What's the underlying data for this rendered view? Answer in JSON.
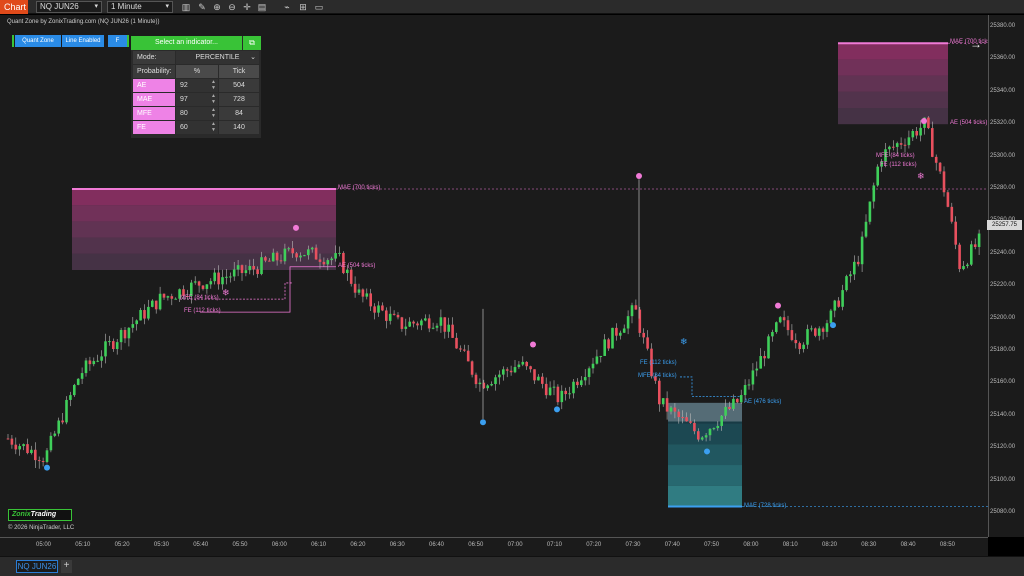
{
  "toolbar": {
    "chart_tab": "Chart",
    "instrument": "NQ JUN26",
    "interval": "1 Minute",
    "icons": [
      "bar-style-icon",
      "draw-tool-icon",
      "zoom-in-icon",
      "zoom-out-icon",
      "crosshair-icon",
      "properties-icon",
      "indicators-icon",
      "strategies-icon",
      "templates-icon"
    ]
  },
  "chart_title": "Quant Zone by ZonixTrading.com (NQ JUN26 (1 Minute))",
  "buttons": {
    "quant_zone": "Quant Zone",
    "line_enabled": "Line Enabled",
    "f": "F"
  },
  "panel": {
    "select_label": "Select an indicator...",
    "mode_label": "Mode:",
    "mode_value": "PERCENTILE",
    "probability_label": "Probability:",
    "pct_header": "%",
    "tick_header": "Tick",
    "rows": [
      {
        "name": "AE",
        "pct": "92",
        "tick": "504"
      },
      {
        "name": "MAE",
        "pct": "97",
        "tick": "728"
      },
      {
        "name": "MFE",
        "pct": "80",
        "tick": "84"
      },
      {
        "name": "FE",
        "pct": "60",
        "tick": "140"
      }
    ]
  },
  "chart_data": {
    "type": "candlestick",
    "instrument": "NQ JUN26",
    "interval": "1 Minute",
    "ylim": [
      25060,
      25390
    ],
    "price_ticks": [
      "25380.00",
      "25360.00",
      "25340.00",
      "25320.00",
      "25300.00",
      "25280.00",
      "25260.00",
      "25240.00",
      "25220.00",
      "25200.00",
      "25180.00",
      "25160.00",
      "25140.00",
      "25120.00",
      "25100.00",
      "25080.00"
    ],
    "time_ticks": [
      "05:00",
      "05:10",
      "05:20",
      "05:30",
      "05:40",
      "05:50",
      "06:00",
      "06:10",
      "06:20",
      "06:30",
      "06:40",
      "06:50",
      "07:00",
      "07:10",
      "07:20",
      "07:30",
      "07:40",
      "07:50",
      "08:00",
      "08:10",
      "08:20",
      "08:30",
      "08:40",
      "08:50"
    ],
    "current_price": "25257.75",
    "zones": [
      {
        "name": "short-zone-1",
        "color": "#f07ad6",
        "top": 25280,
        "bottom": 25230,
        "mae_label": "MAE (700 ticks)",
        "ae_label": "AE (504 ticks)",
        "mfe_label": "MFE (84 ticks)",
        "fe_label": "FE (112 ticks)"
      },
      {
        "name": "long-zone",
        "color": "#3b9ff0",
        "top": 25148,
        "bottom": 25084,
        "mae_label": "MAE (728 ticks)",
        "ae_label": "AE (476 ticks)",
        "mfe_label": "MFE (84 ticks)",
        "fe_label": "FE (112 ticks)"
      },
      {
        "name": "short-zone-2",
        "color": "#f07ad6",
        "top": 25370,
        "bottom": 25320,
        "mae_label": "MAE (700 ticks)",
        "ae_label": "AE (504 ticks)",
        "mfe_label": "MFE (84 ticks)",
        "fe_label": "FE (112 ticks)"
      }
    ],
    "colors": {
      "up": "#3fcf5a",
      "down": "#e8505e",
      "background": "#1b1b1b"
    }
  },
  "footer": {
    "logo_a": "Zonix",
    "logo_b": "Trading",
    "copyright": "© 2026 NinjaTrader, LLC",
    "instrument_tab": "NQ JUN26",
    "add_tab": "+"
  }
}
